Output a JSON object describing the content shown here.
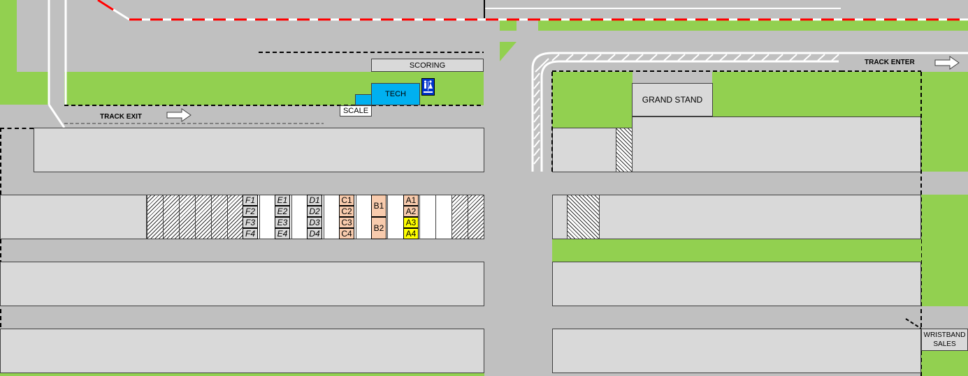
{
  "labels": {
    "scoring": "SCORING",
    "tech": "TECH",
    "scale": "SCALE",
    "grand_stand": "GRAND STAND",
    "track_exit": "TRACK EXIT",
    "track_enter": "TRACK ENTER",
    "wristband_sales_line1": "WRISTBAND",
    "wristband_sales_line2": "SALES"
  },
  "pit_spots": {
    "F": [
      "F1",
      "F2",
      "F3",
      "F4"
    ],
    "E": [
      "E1",
      "E2",
      "E3",
      "E4"
    ],
    "D": [
      "D1",
      "D2",
      "D3",
      "D4"
    ],
    "C": [
      "C1",
      "C2",
      "C3",
      "C4"
    ],
    "B": [
      "B1",
      "B2"
    ],
    "A": [
      "A1",
      "A2",
      "A3",
      "A4"
    ]
  },
  "icons": {
    "restroom": "restroom-icon",
    "track_exit_arrow": "right-arrow-icon",
    "track_enter_arrow": "right-arrow-icon"
  },
  "colors": {
    "grass": "#92d050",
    "pavement": "#c0c0c0",
    "lot": "#d9d9d9",
    "tech": "#00b0f0",
    "peach_spot": "#f8cbad",
    "yellow_spot": "#ffff00",
    "track_red": "#ff0000",
    "restroom_blue": "#0033cc"
  }
}
